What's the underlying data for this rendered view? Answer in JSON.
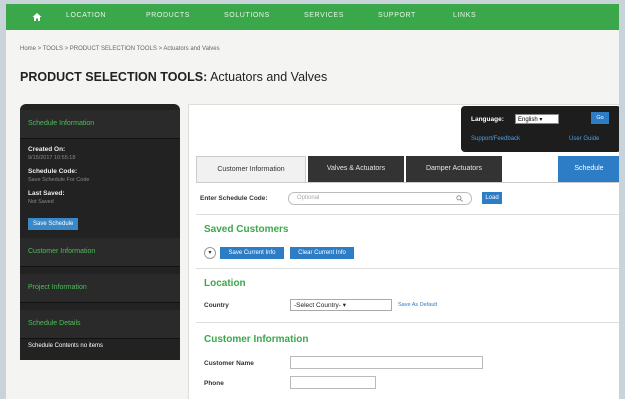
{
  "topnav": {
    "items": [
      "LOCATION",
      "PRODUCTS",
      "SOLUTIONS",
      "SERVICES",
      "SUPPORT",
      "LINKS"
    ]
  },
  "breadcrumb": "Home > TOOLS > PRODUCT SELECTION TOOLS > Actuators and Valves",
  "page_title": {
    "bold": "PRODUCT SELECTION TOOLS:",
    "rest": " Actuators and Valves"
  },
  "sidebar": {
    "schedule_info": "Schedule Information",
    "created_on_label": "Created On:",
    "created_on_value": "9/15/2017 10:55:18",
    "schedule_code_label": "Schedule Code:",
    "schedule_code_value": "Save Schedule For Code",
    "last_saved_label": "Last Saved:",
    "last_saved_value": "Not Saved",
    "save_button": "Save Schedule",
    "customer_info": "Customer Information",
    "project_info": "Project Information",
    "schedule_details": "Schedule Details",
    "schedule_contents": "Schedule Contents no items"
  },
  "language": {
    "label": "Language:",
    "selected": "English",
    "go": "Go",
    "feedback": "Support/Feedback",
    "guide": "User Guide"
  },
  "tabs": {
    "customer": "Customer Information",
    "valves": "Valves & Actuators",
    "damper": "Damper Actuators",
    "schedule": "Schedule"
  },
  "form": {
    "schedule_code_label": "Enter Schedule Code:",
    "schedule_code_placeholder": "Optional",
    "load": "Load",
    "saved_customers": "Saved Customers",
    "save_current": "Save Current Info",
    "clear_current": "Clear Current Info",
    "location": "Location",
    "country_label": "Country",
    "country_select": "-Select Country-",
    "save_as_default": "Save As Default",
    "customer_information": "Customer Information",
    "customer_name_label": "Customer Name",
    "phone_label": "Phone"
  },
  "colors": {
    "brand_green": "#3aa84a",
    "accent_blue": "#2d7cc6",
    "sidebar_dark": "#222222"
  }
}
